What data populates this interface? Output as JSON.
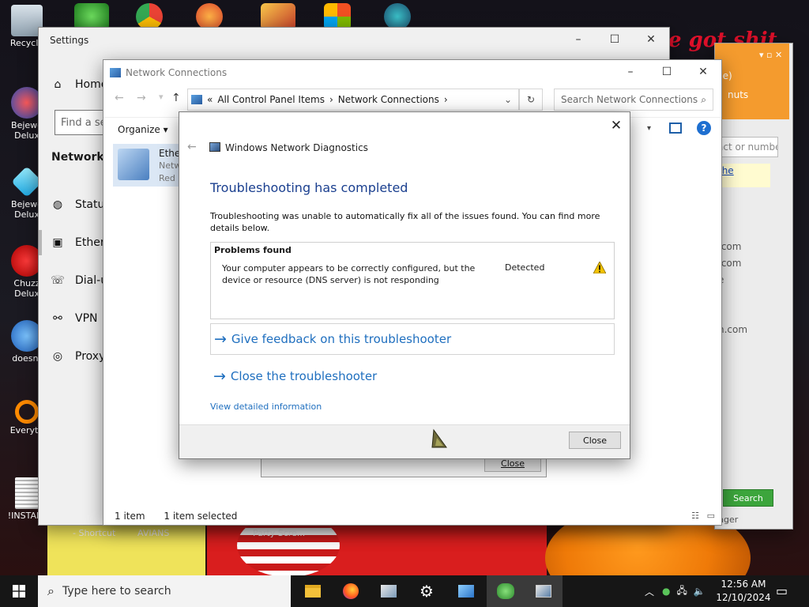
{
  "desktop": {
    "icons": [
      {
        "label": "Recycle"
      },
      {
        "label": "Bejewe\nDelux"
      },
      {
        "label": "Bejewe\nDelux"
      },
      {
        "label": "Chuzz\nDelux"
      },
      {
        "label": "doesnt"
      },
      {
        "label": "Everyth"
      },
      {
        "label": "!INSTALL"
      }
    ],
    "bottom_labels": [
      "- Shortcut",
      "AVIANS",
      "Party Scre..."
    ],
    "deco_text": "e got shit"
  },
  "settings": {
    "title": "Settings",
    "home": "Home",
    "search_placeholder": "Find a setting",
    "heading": "Network & Internet",
    "items": [
      {
        "label": "Status",
        "icon": "status-icon"
      },
      {
        "label": "Ethernet",
        "icon": "ethernet-icon"
      },
      {
        "label": "Dial-up",
        "icon": "dialup-icon"
      },
      {
        "label": "VPN",
        "icon": "vpn-icon"
      },
      {
        "label": "Proxy",
        "icon": "globe-icon"
      }
    ]
  },
  "netconn": {
    "title": "Network Connections",
    "breadcrumb": [
      "All Control Panel Items",
      "Network Connections"
    ],
    "search_placeholder": "Search Network Connections",
    "organize": "Organize",
    "adapter": {
      "name": "Ethernet",
      "line2": "Network",
      "line3": "Red Hat"
    },
    "status_items": "1 item",
    "status_selected": "1 item selected"
  },
  "sidewin": {
    "snippets": [
      "ne)",
      "nuts",
      "act or numbe",
      "the",
      ".com",
      ".com",
      "e",
      "n.com",
      "nger"
    ],
    "search_button": "Search"
  },
  "behind_dialog": {
    "close_label": "Close"
  },
  "diagnostics": {
    "window_title": "Windows Network Diagnostics",
    "heading": "Troubleshooting has completed",
    "description": "Troubleshooting was unable to automatically fix all of the issues found. You can find more details below.",
    "problems_header": "Problems found",
    "problem_text": "Your computer appears to be correctly configured, but the device or resource (DNS server) is not responding",
    "problem_status": "Detected",
    "feedback_link": "Give feedback on this troubleshooter",
    "close_link": "Close the troubleshooter",
    "detail_link": "View detailed information",
    "close_button": "Close"
  },
  "taskbar": {
    "search_placeholder": "Type here to search",
    "time": "12:56 AM",
    "date": "12/10/2024"
  }
}
